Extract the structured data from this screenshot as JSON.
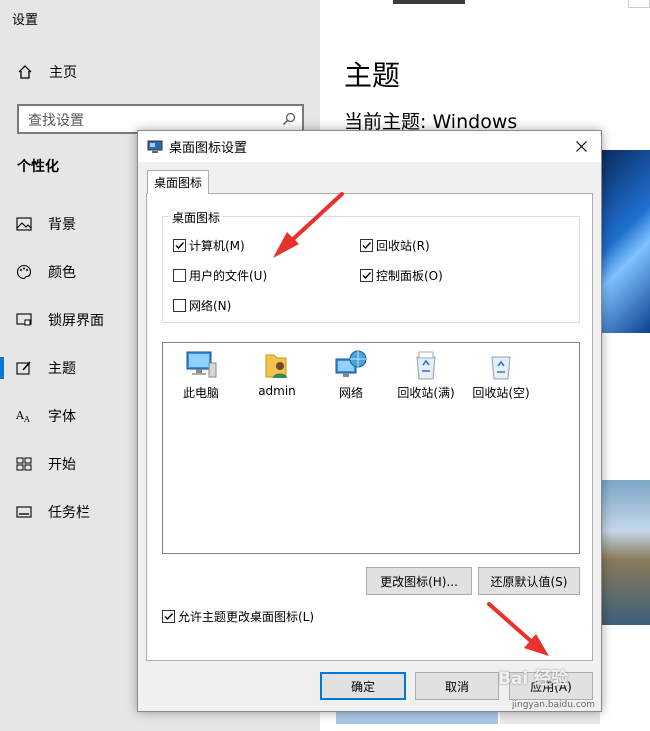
{
  "settings": {
    "window_title": "设置",
    "home_label": "主页",
    "search_placeholder": "查找设置",
    "section_title": "个性化",
    "nav": [
      {
        "label": "背景",
        "icon": "picture-icon"
      },
      {
        "label": "颜色",
        "icon": "palette-icon"
      },
      {
        "label": "锁屏界面",
        "icon": "lock-screen-icon"
      },
      {
        "label": "主题",
        "icon": "theme-brush-icon",
        "active": true
      },
      {
        "label": "字体",
        "icon": "font-icon"
      },
      {
        "label": "开始",
        "icon": "start-grid-icon"
      },
      {
        "label": "任务栏",
        "icon": "taskbar-icon"
      }
    ],
    "main_title": "主题",
    "current_theme": "当前主题: Windows",
    "accent_color": "#0078d7"
  },
  "dialog": {
    "title": "桌面图标设置",
    "tab_label": "桌面图标",
    "group_label": "桌面图标",
    "checkboxes": [
      {
        "label": "计算机(M)",
        "checked": true
      },
      {
        "label": "回收站(R)",
        "checked": true
      },
      {
        "label": "用户的文件(U)",
        "checked": false
      },
      {
        "label": "控制面板(O)",
        "checked": true
      },
      {
        "label": "网络(N)",
        "checked": false
      }
    ],
    "icons": [
      {
        "label": "此电脑",
        "icon": "computer-icon"
      },
      {
        "label": "admin",
        "icon": "user-folder-icon"
      },
      {
        "label": "网络",
        "icon": "network-icon"
      },
      {
        "label": "回收站(满)",
        "icon": "recycle-bin-full-icon"
      },
      {
        "label": "回收站(空)",
        "icon": "recycle-bin-empty-icon"
      }
    ],
    "change_icon_label": "更改图标(H)...",
    "restore_default_label": "还原默认值(S)",
    "allow_theme_label": "允许主题更改桌面图标(L)",
    "allow_theme_checked": true,
    "ok_label": "确定",
    "cancel_label": "取消",
    "apply_label": "应用(A)"
  },
  "annotation": {
    "arrow_color": "#e8322b"
  },
  "watermark": {
    "brand": "Bai 经验",
    "url": "jingyan.baidu.com"
  }
}
